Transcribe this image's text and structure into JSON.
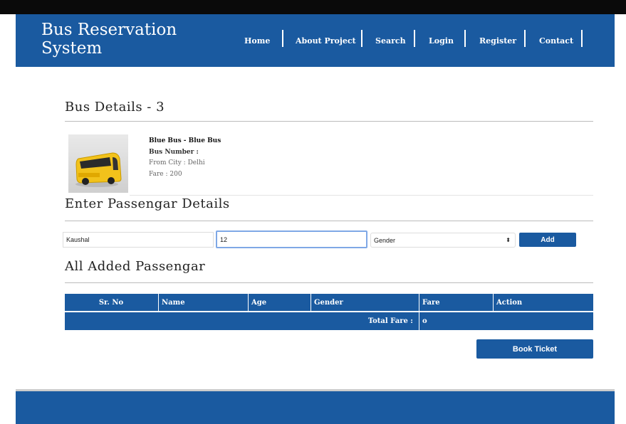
{
  "brand": {
    "line1": "Bus Reservation",
    "line2": "System"
  },
  "nav": {
    "home": "Home",
    "about": "About Project",
    "search": "Search",
    "login": "Login",
    "register": "Register",
    "contact": "Contact"
  },
  "bus_details": {
    "heading": "Bus Details - 3",
    "bus_name": "Blue Bus - Blue Bus",
    "bus_number": "Bus Number :",
    "from_city": "From City : Delhi",
    "fare": "Fare : 200"
  },
  "passenger_form": {
    "heading": "Enter Passengar Details",
    "name_value": "Kaushal",
    "age_value": "12",
    "gender_selected": "Gender",
    "add_label": "Add"
  },
  "passenger_table": {
    "heading": "All Added Passengar",
    "columns": [
      "Sr. No",
      "Name",
      "Age",
      "Gender",
      "Fare",
      "Action"
    ],
    "total_label": "Total Fare :",
    "total_value": "o"
  },
  "book_label": "Book Ticket",
  "colors": {
    "primary": "#1a5aa0",
    "topbar": "#0a0a0a"
  }
}
